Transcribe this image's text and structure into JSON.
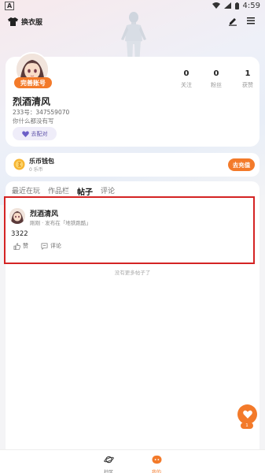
{
  "status_bar": {
    "left_label": "A",
    "time": "4:59"
  },
  "header": {
    "dress_label": "换衣服"
  },
  "profile": {
    "badge": "完善账号",
    "name": "烈酒清风",
    "uid": "233号：347559070",
    "bio": "你什么都没有写",
    "pair_button": "去配对",
    "stats": [
      {
        "value": "0",
        "label": "关注"
      },
      {
        "value": "0",
        "label": "粉丝"
      },
      {
        "value": "1",
        "label": "获赞"
      }
    ]
  },
  "wallet": {
    "title": "乐币钱包",
    "balance": "0 乐币",
    "recharge": "去充值"
  },
  "tabs": [
    {
      "label": "最近在玩",
      "active": false
    },
    {
      "label": "作品栏",
      "active": false
    },
    {
      "label": "帖子",
      "active": true
    },
    {
      "label": "评论",
      "active": false
    }
  ],
  "post": {
    "author": "烈酒清风",
    "meta": "刚刚 · 发布在「地铁跑酷」",
    "content": "3322",
    "like_label": "赞",
    "comment_label": "评论"
  },
  "no_more": "没有更多帖子了",
  "float_badge": "1",
  "bottom_nav": [
    {
      "label": "社区",
      "icon": "planet-icon",
      "active": false
    },
    {
      "label": "我的",
      "icon": "face-icon",
      "active": true
    }
  ],
  "colors": {
    "accent": "#f37a2a",
    "highlight": "#d42424"
  }
}
